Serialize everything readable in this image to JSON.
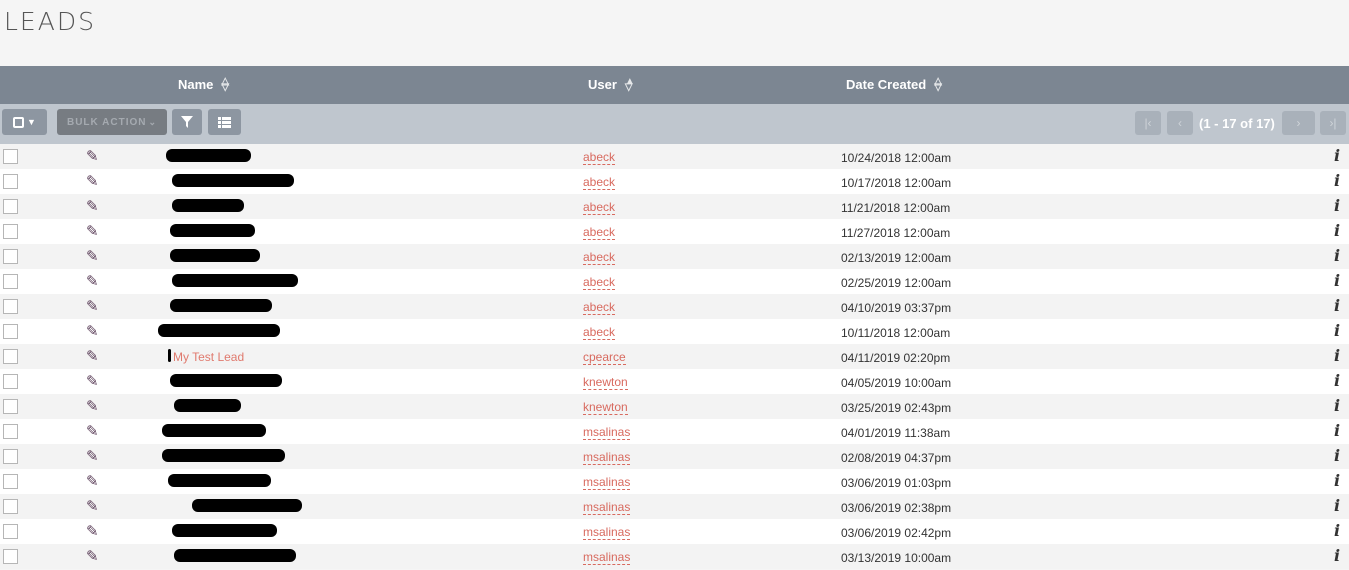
{
  "page": {
    "title": "LEADS"
  },
  "columns": {
    "name": "Name",
    "user": "User",
    "date_created": "Date Created"
  },
  "toolbar": {
    "select_label": "▢",
    "bulk_action_label": "BULK ACTION",
    "filter_icon": "filter-icon",
    "columns_icon": "list-icon",
    "pagination_text": "(1 - 17 of 17)"
  },
  "rows": [
    {
      "user": "abeck",
      "date": "10/24/2018 12:00am",
      "name": ""
    },
    {
      "user": "abeck",
      "date": "10/17/2018 12:00am",
      "name": ""
    },
    {
      "user": "abeck",
      "date": "11/21/2018 12:00am",
      "name": ""
    },
    {
      "user": "abeck",
      "date": "11/27/2018 12:00am",
      "name": ""
    },
    {
      "user": "abeck",
      "date": "02/13/2019 12:00am",
      "name": ""
    },
    {
      "user": "abeck",
      "date": "02/25/2019 12:00am",
      "name": ""
    },
    {
      "user": "abeck",
      "date": "04/10/2019 03:37pm",
      "name": ""
    },
    {
      "user": "abeck",
      "date": "10/11/2018 12:00am",
      "name": ""
    },
    {
      "user": "cpearce",
      "date": "04/11/2019 02:20pm",
      "name": "My Test Lead"
    },
    {
      "user": "knewton",
      "date": "04/05/2019 10:00am",
      "name": ""
    },
    {
      "user": "knewton",
      "date": "03/25/2019 02:43pm",
      "name": ""
    },
    {
      "user": "msalinas",
      "date": "04/01/2019 11:38am",
      "name": ""
    },
    {
      "user": "msalinas",
      "date": "02/08/2019 04:37pm",
      "name": ""
    },
    {
      "user": "msalinas",
      "date": "03/06/2019 01:03pm",
      "name": ""
    },
    {
      "user": "msalinas",
      "date": "03/06/2019 02:38pm",
      "name": ""
    },
    {
      "user": "msalinas",
      "date": "03/06/2019 02:42pm",
      "name": ""
    },
    {
      "user": "msalinas",
      "date": "03/13/2019 10:00am",
      "name": ""
    }
  ]
}
